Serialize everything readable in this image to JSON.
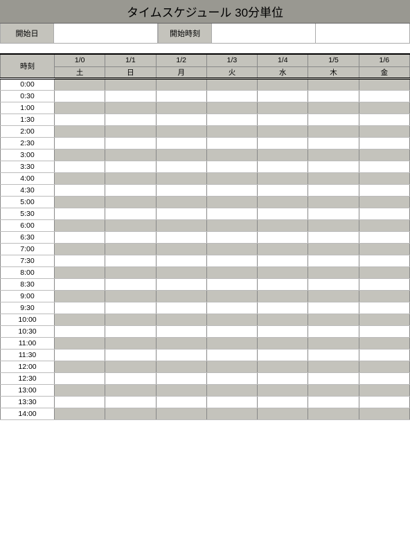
{
  "title": "タイムスケジュール 30分単位",
  "inputs": {
    "start_date_label": "開始日",
    "start_date_value": "",
    "start_time_label": "開始時刻",
    "start_time_value": ""
  },
  "header": {
    "time_label": "時刻",
    "dates": [
      "1/0",
      "1/1",
      "1/2",
      "1/3",
      "1/4",
      "1/5",
      "1/6"
    ],
    "daynames": [
      "土",
      "日",
      "月",
      "火",
      "水",
      "木",
      "金"
    ]
  },
  "times": [
    "0:00",
    "0:30",
    "1:00",
    "1:30",
    "2:00",
    "2:30",
    "3:00",
    "3:30",
    "4:00",
    "4:30",
    "5:00",
    "5:30",
    "6:00",
    "6:30",
    "7:00",
    "7:30",
    "8:00",
    "8:30",
    "9:00",
    "9:30",
    "10:00",
    "10:30",
    "11:00",
    "11:30",
    "12:00",
    "12:30",
    "13:00",
    "13:30",
    "14:00"
  ]
}
